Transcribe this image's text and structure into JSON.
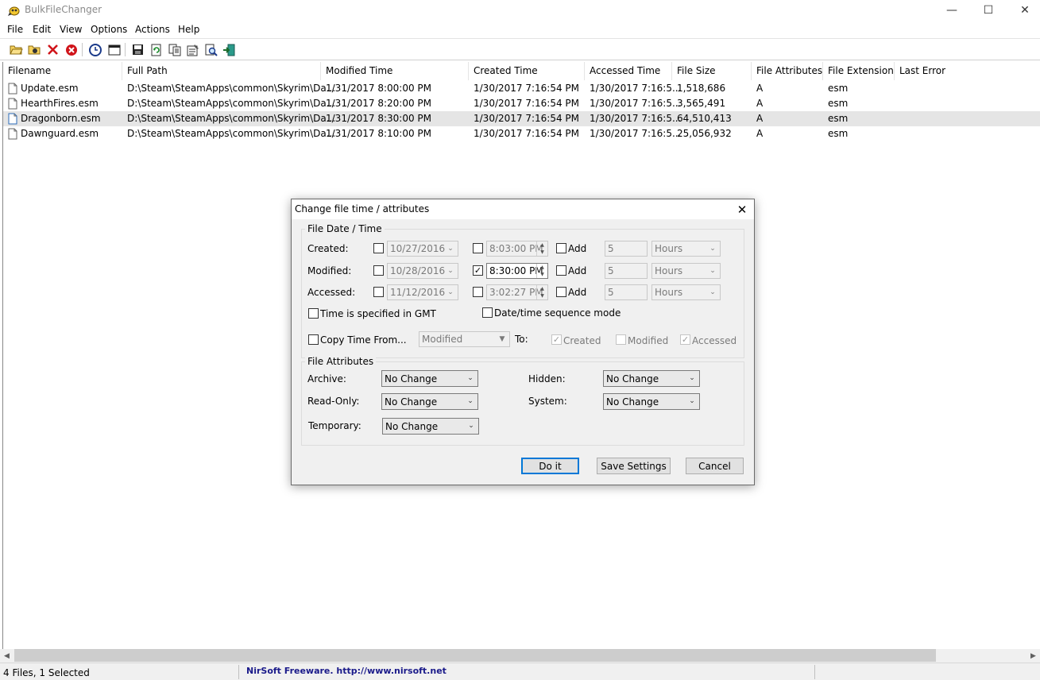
{
  "window": {
    "title": "BulkFileChanger",
    "minimize": "—",
    "maximize": "☐",
    "close": "✕"
  },
  "menu": [
    "File",
    "Edit",
    "View",
    "Options",
    "Actions",
    "Help"
  ],
  "toolbar": {
    "icons": [
      "open-folder-icon",
      "add-files-icon",
      "remove-icon",
      "remove-all-icon",
      "clock-icon",
      "window-icon",
      "save-icon",
      "refresh-icon",
      "copy-icon",
      "properties-icon",
      "find-icon",
      "exit-icon"
    ]
  },
  "list": {
    "columns": [
      "Filename",
      "Full Path",
      "Modified Time",
      "Created Time",
      "Accessed Time",
      "File Size",
      "File Attributes",
      "File Extension",
      "Last Error"
    ],
    "rows": [
      {
        "filename": "Update.esm",
        "path": "D:\\Steam\\SteamApps\\common\\Skyrim\\Da...",
        "modified": "1/31/2017 8:00:00 PM",
        "created": "1/30/2017 7:16:54 PM",
        "accessed": "1/30/2017 7:16:5...",
        "size": "1,518,686",
        "attributes": "A",
        "extension": "esm",
        "error": "",
        "selected": false
      },
      {
        "filename": "HearthFires.esm",
        "path": "D:\\Steam\\SteamApps\\common\\Skyrim\\Da...",
        "modified": "1/31/2017 8:20:00 PM",
        "created": "1/30/2017 7:16:54 PM",
        "accessed": "1/30/2017 7:16:5...",
        "size": "3,565,491",
        "attributes": "A",
        "extension": "esm",
        "error": "",
        "selected": false
      },
      {
        "filename": "Dragonborn.esm",
        "path": "D:\\Steam\\SteamApps\\common\\Skyrim\\Da...",
        "modified": "1/31/2017 8:30:00 PM",
        "created": "1/30/2017 7:16:54 PM",
        "accessed": "1/30/2017 7:16:5...",
        "size": "64,510,413",
        "attributes": "A",
        "extension": "esm",
        "error": "",
        "selected": true
      },
      {
        "filename": "Dawnguard.esm",
        "path": "D:\\Steam\\SteamApps\\common\\Skyrim\\Da...",
        "modified": "1/31/2017 8:10:00 PM",
        "created": "1/30/2017 7:16:54 PM",
        "accessed": "1/30/2017 7:16:5...",
        "size": "25,056,932",
        "attributes": "A",
        "extension": "esm",
        "error": "",
        "selected": false
      }
    ]
  },
  "status": {
    "left": "4 Files, 1 Selected",
    "link": "NirSoft Freeware.  http://www.nirsoft.net"
  },
  "dialog": {
    "title": "Change file time / attributes",
    "close": "✕",
    "datetime_group": "File Date / Time",
    "rows": [
      {
        "label": "Created:",
        "date_checked": false,
        "date": "10/27/2016",
        "time_checked": false,
        "time": "8:03:00 PM",
        "add_label": "Add",
        "add_checked": false,
        "amount": "5",
        "unit": "Hours"
      },
      {
        "label": "Modified:",
        "date_checked": false,
        "date": "10/28/2016",
        "time_checked": true,
        "time": "8:30:00 PM",
        "add_label": "Add",
        "add_checked": false,
        "amount": "5",
        "unit": "Hours"
      },
      {
        "label": "Accessed:",
        "date_checked": false,
        "date": "11/12/2016",
        "time_checked": false,
        "time": "3:02:27 PM",
        "add_label": "Add",
        "add_checked": false,
        "amount": "5",
        "unit": "Hours"
      }
    ],
    "gmt_label": "Time is specified in GMT",
    "sequence_label": "Date/time sequence mode",
    "copy_label": "Copy Time From...",
    "copy_source": "Modified",
    "to_label": "To:",
    "to_created": "Created",
    "to_modified": "Modified",
    "to_accessed": "Accessed",
    "attributes_group": "File Attributes",
    "archive_label": "Archive:",
    "archive_value": "No Change",
    "hidden_label": "Hidden:",
    "hidden_value": "No Change",
    "readonly_label": "Read-Only:",
    "readonly_value": "No Change",
    "system_label": "System:",
    "system_value": "No Change",
    "temporary_label": "Temporary:",
    "temporary_value": "No Change",
    "doit_button": "Do it",
    "save_button": "Save Settings",
    "cancel_button": "Cancel",
    "check_mark": "✓"
  }
}
